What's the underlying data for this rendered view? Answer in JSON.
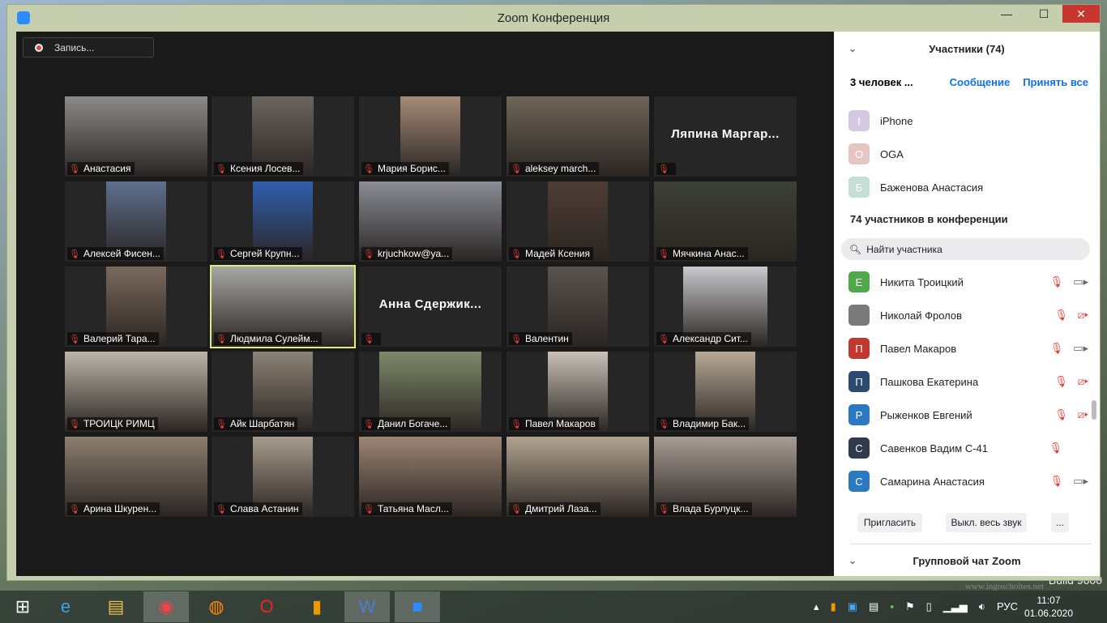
{
  "window": {
    "title": "Zoom Конференция",
    "minimize": "—",
    "maximize": "☐",
    "close": "✕"
  },
  "recording": {
    "label": "Запись..."
  },
  "tiles": [
    {
      "name": "Анастасия",
      "video": true
    },
    {
      "name": "Ксения Лосев...",
      "video": true
    },
    {
      "name": "Мария Борис...",
      "video": true
    },
    {
      "name": "aleksey march...",
      "video": true
    },
    {
      "name": "",
      "display": "Ляпина  Маргар...",
      "video": false
    },
    {
      "name": "Алексей Фисен...",
      "video": true
    },
    {
      "name": "Сергей Крупн...",
      "video": true
    },
    {
      "name": "krjuchkow@ya...",
      "video": true
    },
    {
      "name": "Мадей Ксения",
      "video": true
    },
    {
      "name": "Мячкина Анас...",
      "video": true
    },
    {
      "name": "Валерий Тара...",
      "video": true
    },
    {
      "name": "Людмила Сулейм...",
      "video": true,
      "active": true
    },
    {
      "name": "",
      "display": "Анна  Сдержик...",
      "video": false
    },
    {
      "name": "Валентин",
      "video": true
    },
    {
      "name": "Александр Сит...",
      "video": true
    },
    {
      "name": "ТРОИЦК РИМЦ",
      "video": true
    },
    {
      "name": "Айк Шарбатян",
      "video": true
    },
    {
      "name": "Данил Богаче...",
      "video": true
    },
    {
      "name": "Павел Макаров",
      "video": true
    },
    {
      "name": "Владимир Бак...",
      "video": true
    },
    {
      "name": "Арина Шкурен...",
      "video": true
    },
    {
      "name": "Слава Астанин",
      "video": true
    },
    {
      "name": "Татьяна Масл...",
      "video": true
    },
    {
      "name": "Дмитрий Лаза...",
      "video": true
    },
    {
      "name": "Влада Бурлуцк...",
      "video": true
    }
  ],
  "panel": {
    "title": "Участники (74)",
    "waiting_label": "3 человек ...",
    "message": "Сообщение",
    "admit_all": "Принять все",
    "waiting": [
      {
        "initial": "I",
        "name": "iPhone",
        "color": "#d5c8e2"
      },
      {
        "initial": "O",
        "name": "OGA",
        "color": "#e7c5c2"
      },
      {
        "initial": "Б",
        "name": "Баженова Анастасия",
        "color": "#c5dfd4"
      }
    ],
    "in_meeting": "74 участников в конференции",
    "search_placeholder": "Найти участника",
    "participants": [
      {
        "initial": "E",
        "name": "Никита Троицкий",
        "color": "#4fa84a",
        "mic": "muted",
        "video": "on"
      },
      {
        "initial": "",
        "name": "Николай Фролов",
        "color": "#7a7a7a",
        "mic": "muted",
        "video": "off"
      },
      {
        "initial": "П",
        "name": "Павел Макаров",
        "color": "#c2382e",
        "mic": "muted",
        "video": "on"
      },
      {
        "initial": "П",
        "name": "Пашкова Екатерина",
        "color": "#2b4a6e",
        "mic": "muted",
        "video": "off"
      },
      {
        "initial": "Р",
        "name": "Рыженков Евгений",
        "color": "#2b79c2",
        "mic": "muted",
        "video": "off"
      },
      {
        "initial": "С",
        "name": "Савенков Вадим С-41",
        "color": "#2f3b4c",
        "mic": "muted",
        "video": "none"
      },
      {
        "initial": "С",
        "name": "Самарина Анастасия",
        "color": "#2b79c2",
        "mic": "muted",
        "video": "on"
      }
    ],
    "invite": "Пригласить",
    "mute_all": "Выкл. весь звук",
    "more": "...",
    "chat": "Групповой чат Zoom"
  },
  "taskbar": {
    "lang": "РУС",
    "time": "11:07",
    "date": "01.06.2020"
  },
  "desktop": {
    "watermark": "www.ingoscholtes.net",
    "build": "Build 9600"
  }
}
